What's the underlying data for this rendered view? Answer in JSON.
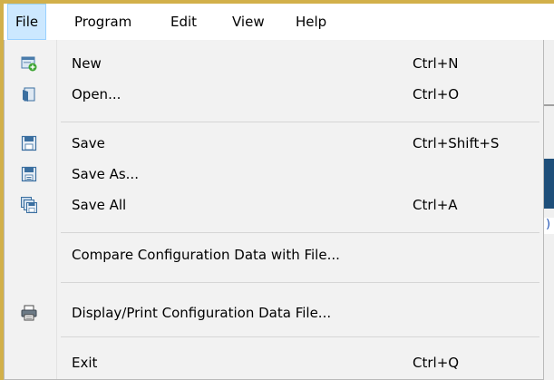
{
  "menubar": {
    "items": [
      {
        "label": "File"
      },
      {
        "label": "Program"
      },
      {
        "label": "Edit"
      },
      {
        "label": "View"
      },
      {
        "label": "Help"
      }
    ]
  },
  "file_menu": {
    "items": [
      {
        "label": "New",
        "shortcut": "Ctrl+N",
        "icon": "new-file-icon"
      },
      {
        "label": "Open...",
        "shortcut": "Ctrl+O",
        "icon": "open-folder-icon"
      },
      {
        "label": "Save",
        "shortcut": "Ctrl+Shift+S",
        "icon": "save-icon"
      },
      {
        "label": "Save As...",
        "shortcut": "",
        "icon": "save-as-icon"
      },
      {
        "label": "Save All",
        "shortcut": "Ctrl+A",
        "icon": "save-all-icon"
      },
      {
        "label": "Compare Configuration Data with File...",
        "shortcut": ""
      },
      {
        "label": "Display/Print Configuration Data File...",
        "shortcut": "",
        "icon": "printer-icon"
      },
      {
        "label": "Exit",
        "shortcut": "Ctrl+Q"
      }
    ]
  },
  "colors": {
    "menu_active_bg": "#cce8ff",
    "menu_bg": "#f2f2f2",
    "window_frame": "#d2b04a"
  }
}
